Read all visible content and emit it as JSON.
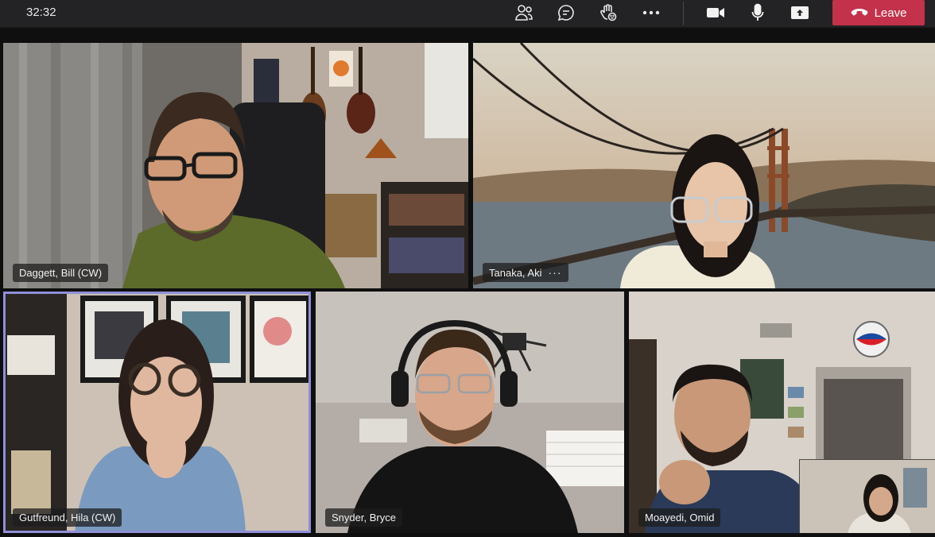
{
  "call": {
    "timer": "32:32",
    "leave_label": "Leave"
  },
  "toolbar": {
    "icons": [
      "participants-icon",
      "chat-icon",
      "raise-hand-icon",
      "more-actions-icon",
      "camera-icon",
      "microphone-icon",
      "share-screen-icon",
      "hang-up-icon"
    ]
  },
  "participants": [
    {
      "name": "Daggett, Bill (CW)"
    },
    {
      "name": "Tanaka, Aki",
      "menu": "···"
    },
    {
      "name": "Gutfreund, Hila (CW)"
    },
    {
      "name": "Snyder, Bryce"
    },
    {
      "name": "Moayedi, Omid"
    }
  ],
  "colors": {
    "toolbar_bg": "#232325",
    "leave_red": "#c4314b",
    "active_speaker_ring": "#8f8fd8"
  }
}
